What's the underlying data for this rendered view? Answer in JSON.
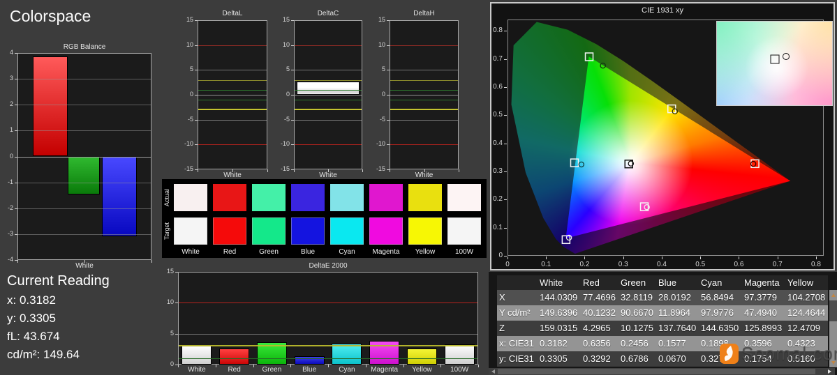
{
  "title": "Colorspace",
  "current_reading": {
    "heading": "Current Reading",
    "lines": [
      {
        "label": "x",
        "value": "0.3182"
      },
      {
        "label": "y",
        "value": "0.3305"
      },
      {
        "label": "fL",
        "value": "43.674"
      },
      {
        "label": "cd/m²",
        "value": "149.64"
      }
    ]
  },
  "charts": {
    "rgb_balance": {
      "type": "bar",
      "title": "RGB Balance",
      "xlabel": "White",
      "ylim": [
        -4,
        4
      ],
      "yticks": [
        4,
        3,
        2,
        1,
        0,
        -1,
        -2,
        -3,
        -4
      ],
      "series": [
        {
          "name": "Red",
          "value": 3.87,
          "colors": [
            "#ff5a5a",
            "#c40000"
          ]
        },
        {
          "name": "Green",
          "value": -1.47,
          "colors": [
            "#2fb92f",
            "#0a7a0a"
          ]
        },
        {
          "name": "Blue",
          "value": -3.08,
          "colors": [
            "#4848ff",
            "#0808c0"
          ]
        }
      ]
    },
    "deltaL": {
      "type": "bar",
      "title": "DeltaL",
      "xlabel": "White",
      "ylim": [
        -15,
        15
      ],
      "yticks": [
        15,
        10,
        5,
        0,
        -5,
        -10,
        -15
      ],
      "values": [
        0
      ],
      "ref_lines": [
        {
          "y": 10,
          "color": "#9a2d26",
          "width": 1
        },
        {
          "y": -10,
          "color": "#b3241e",
          "width": 1
        },
        {
          "y": 5,
          "color": "#7b7b7b",
          "width": 1
        },
        {
          "y": -5,
          "color": "#7b7b7b",
          "width": 1
        },
        {
          "y": 3,
          "color": "#8e8e2c",
          "width": 1
        },
        {
          "y": -3,
          "color": "#cdcd30",
          "width": 2
        },
        {
          "y": 1,
          "color": "#2e7c2e",
          "width": 1
        },
        {
          "y": -1,
          "color": "#2e7c2e",
          "width": 1
        },
        {
          "y": 0,
          "color": "#9a9a9a",
          "width": 1
        }
      ]
    },
    "deltaC": {
      "type": "bar",
      "title": "DeltaC",
      "xlabel": "White",
      "ylim": [
        -15,
        15
      ],
      "yticks": [
        15,
        10,
        5,
        0,
        -5,
        -10,
        -15
      ],
      "values": [
        2.7
      ],
      "ref_lines": [
        {
          "y": 10,
          "color": "#9a2d26",
          "width": 1
        },
        {
          "y": -10,
          "color": "#b3241e",
          "width": 1
        },
        {
          "y": 5,
          "color": "#7b7b7b",
          "width": 1
        },
        {
          "y": -5,
          "color": "#7b7b7b",
          "width": 1
        },
        {
          "y": 3,
          "color": "#8e8e2c",
          "width": 1
        },
        {
          "y": -3,
          "color": "#cdcd30",
          "width": 2
        },
        {
          "y": 1,
          "color": "#2e7c2e",
          "width": 1
        },
        {
          "y": -1,
          "color": "#2e7c2e",
          "width": 1
        },
        {
          "y": 0,
          "color": "#9a9a9a",
          "width": 1
        }
      ]
    },
    "deltaH": {
      "type": "bar",
      "title": "DeltaH",
      "xlabel": "White",
      "ylim": [
        -15,
        15
      ],
      "yticks": [
        15,
        10,
        5,
        0,
        -5,
        -10,
        -15
      ],
      "values": [
        0
      ],
      "ref_lines": [
        {
          "y": 10,
          "color": "#9a2d26",
          "width": 1
        },
        {
          "y": -10,
          "color": "#b3241e",
          "width": 1
        },
        {
          "y": 5,
          "color": "#7b7b7b",
          "width": 1
        },
        {
          "y": -5,
          "color": "#7b7b7b",
          "width": 1
        },
        {
          "y": 3,
          "color": "#8e8e2c",
          "width": 1
        },
        {
          "y": -3,
          "color": "#cdcd30",
          "width": 2
        },
        {
          "y": 1,
          "color": "#2e7c2e",
          "width": 1
        },
        {
          "y": -1,
          "color": "#2e7c2e",
          "width": 1
        },
        {
          "y": 0,
          "color": "#9a9a9a",
          "width": 1
        }
      ]
    },
    "deltaE2000": {
      "type": "bar",
      "title": "DeltaE 2000",
      "categories": [
        "White",
        "Red",
        "Green",
        "Blue",
        "Cyan",
        "Magenta",
        "Yellow",
        "100W"
      ],
      "values": [
        3.0,
        2.6,
        3.65,
        1.35,
        3.35,
        3.8,
        2.65,
        3.3
      ],
      "bar_colors": [
        [
          "#ffffff",
          "#cfcfcf"
        ],
        [
          "#ff4040",
          "#cc0707"
        ],
        [
          "#3ae83a",
          "#0cb50c"
        ],
        [
          "#3c3cec",
          "#0d0dbb"
        ],
        [
          "#50eef2",
          "#0cc2ca"
        ],
        [
          "#f34df3",
          "#cf10cf"
        ],
        [
          "#f5f535",
          "#cfcf05"
        ],
        [
          "#ffffff",
          "#cfcfcf"
        ]
      ],
      "ylim": [
        0,
        15
      ],
      "yticks": [
        15,
        10,
        5,
        0
      ],
      "ref_lines": [
        {
          "y": 10,
          "color": "#c22420",
          "width": 1
        },
        {
          "y": 5,
          "color": "#7b7b7b",
          "width": 1
        },
        {
          "y": 3,
          "color": "#b9b92c",
          "width": 2
        },
        {
          "y": 1,
          "color": "#266c26",
          "width": 1
        }
      ]
    },
    "cie": {
      "type": "scatter",
      "title": "CIE 1931 xy",
      "xlim": [
        0,
        0.82
      ],
      "ylim": [
        0,
        0.84
      ],
      "xticks": [
        0,
        0.1,
        0.2,
        0.3,
        0.4,
        0.5,
        0.6,
        0.7,
        0.8
      ],
      "yticks": [
        0,
        0.1,
        0.2,
        0.3,
        0.4,
        0.5,
        0.6,
        0.7,
        0.8
      ],
      "gamut_triangle": [
        [
          0.21,
          0.71
        ],
        [
          0.15,
          0.06
        ],
        [
          0.735,
          0.265
        ]
      ],
      "points": [
        {
          "name": "white",
          "target": [
            0.3127,
            0.329
          ],
          "measured": [
            0.3182,
            0.3305
          ],
          "square_color": "#111111",
          "circle_color": "#111111"
        },
        {
          "name": "red",
          "target": [
            0.64,
            0.33
          ],
          "measured": [
            0.6356,
            0.3292
          ],
          "square_color": "#f5f5f5",
          "circle_color": "#3a0000"
        },
        {
          "name": "green",
          "target": [
            0.21,
            0.71
          ],
          "measured": [
            0.2456,
            0.6786
          ],
          "square_color": "#f5f5f5",
          "circle_color": "#113311"
        },
        {
          "name": "blue",
          "target": [
            0.15,
            0.06
          ],
          "measured": [
            0.1577,
            0.067
          ],
          "square_color": "#f5f5f5",
          "circle_color": "#e8e8e8"
        },
        {
          "name": "cyan",
          "target": [
            0.172,
            0.333
          ],
          "measured": [
            0.1898,
            0.3272
          ],
          "square_color": "#f5f5f5",
          "circle_color": "#114444"
        },
        {
          "name": "magenta",
          "target": [
            0.353,
            0.177
          ],
          "measured": [
            0.3596,
            0.1754
          ],
          "square_color": "#f5f5f5",
          "circle_color": "#f0f0f0"
        },
        {
          "name": "yellow",
          "target": [
            0.424,
            0.525
          ],
          "measured": [
            0.4323,
            0.516
          ],
          "square_color": "#f5f5f5",
          "circle_color": "#333300"
        }
      ]
    }
  },
  "swatches": {
    "row_labels": [
      "Actual",
      "Target"
    ],
    "columns": [
      {
        "label": "White",
        "actual": "#f8f0f0",
        "target": "#f5f5f5"
      },
      {
        "label": "Red",
        "actual": "#e81616",
        "target": "#f50a0a"
      },
      {
        "label": "Green",
        "actual": "#44f0a8",
        "target": "#14e88a"
      },
      {
        "label": "Blue",
        "actual": "#3a25e0",
        "target": "#1414e0"
      },
      {
        "label": "Cyan",
        "actual": "#82e3e8",
        "target": "#0ae8f0"
      },
      {
        "label": "Magenta",
        "actual": "#e017cf",
        "target": "#f00ae0"
      },
      {
        "label": "Yellow",
        "actual": "#e9e00f",
        "target": "#f7f704"
      },
      {
        "label": "100W",
        "actual": "#fdf4f4",
        "target": "#f5f5f5"
      }
    ]
  },
  "table": {
    "headers": [
      "",
      "White",
      "Red",
      "Green",
      "Blue",
      "Cyan",
      "Magenta",
      "Yellow"
    ],
    "rows": [
      {
        "label": "X",
        "values": [
          "144.0309",
          "77.4696",
          "32.8119",
          "28.0192",
          "56.8494",
          "97.3779",
          "104.2708"
        ]
      },
      {
        "label": "Y cd/m²",
        "values": [
          "149.6396",
          "40.1232",
          "90.6670",
          "11.8964",
          "97.9776",
          "47.4940",
          "124.4644"
        ]
      },
      {
        "label": "Z",
        "values": [
          "159.0315",
          "4.2965",
          "10.1275",
          "137.7640",
          "144.6350",
          "125.8993",
          "12.4709"
        ]
      },
      {
        "label": "x: CIE31",
        "values": [
          "0.3182",
          "0.6356",
          "0.2456",
          "0.1577",
          "0.1898",
          "0.3596",
          "0.4323"
        ]
      },
      {
        "label": "y: CIE31",
        "values": [
          "0.3305",
          "0.3292",
          "0.6786",
          "0.0670",
          "0.3272",
          "0.1754",
          "0.5160"
        ]
      }
    ]
  },
  "watermark": {
    "text": "Soomal.com",
    "logo_color": "#ef8018"
  }
}
